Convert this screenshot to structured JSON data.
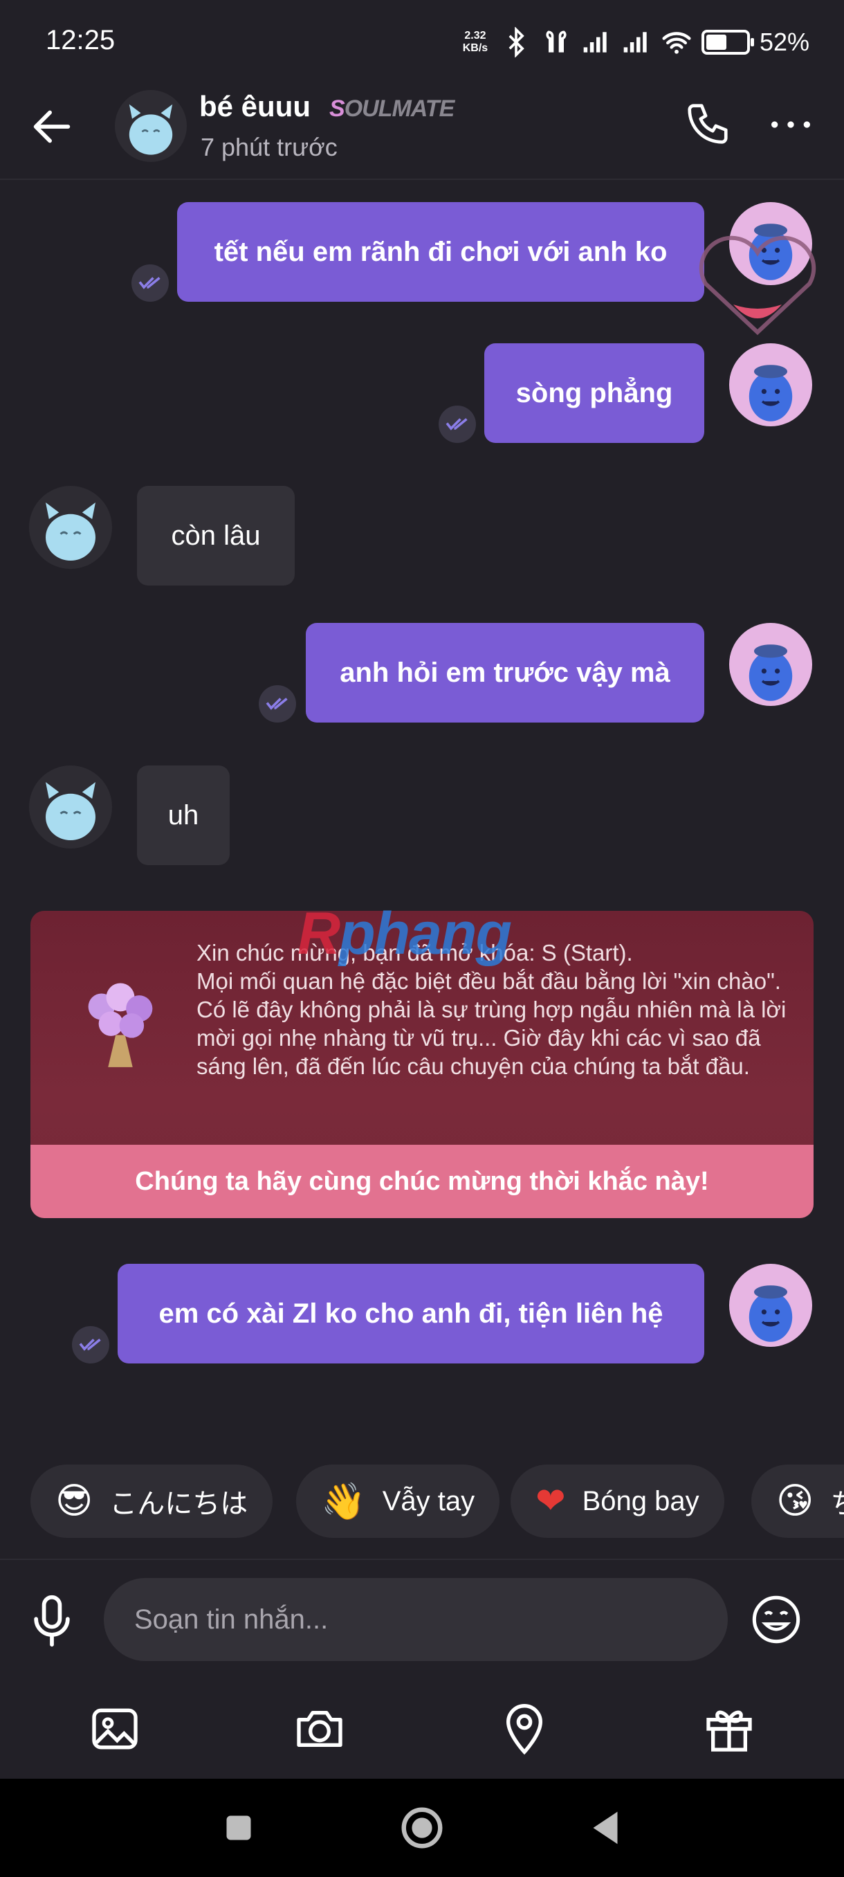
{
  "status_bar": {
    "time": "12:25",
    "net_speed_value": "2.32",
    "net_speed_unit": "KB/s",
    "battery_percent": "52%",
    "battery_level": 0.52
  },
  "header": {
    "contact_name": "bé êuuu",
    "badge_prefix": "S",
    "badge_rest": "OULMATE",
    "last_seen": "7 phút trước"
  },
  "messages": [
    {
      "direction": "out",
      "text": "tết nếu em rãnh đi chơi với anh ko"
    },
    {
      "direction": "out",
      "text": "sòng phẳng"
    },
    {
      "direction": "in",
      "text": "còn lâu"
    },
    {
      "direction": "out",
      "text": "anh hỏi em trước vậy mà"
    },
    {
      "direction": "in",
      "text": "uh"
    },
    {
      "direction": "out",
      "text": "em có xài Zl ko cho anh đi, tiện liên hệ"
    }
  ],
  "unlock_card": {
    "text": "Xin chúc mừng, bạn đã mở khóa: S (Start).\nMọi mối quan hệ đặc biệt đều bắt đầu bằng lời \"xin chào\". Có lẽ đây không phải là sự trùng hợp ngẫu nhiên mà là lời mời gọi nhẹ nhàng từ vũ trụ... Giờ đây khi các vì sao đã sáng lên, đã đến lúc câu chuyện của chúng ta bắt đầu.",
    "cta": "Chúng ta hãy cùng chúc mừng thời khắc này!"
  },
  "watermark": {
    "first": "R",
    "rest": "phang"
  },
  "quick_replies": [
    {
      "emoji": "😎",
      "label": "こんにちは"
    },
    {
      "emoji": "👋",
      "label": "Vẫy tay"
    },
    {
      "emoji": "❤",
      "label": "Bóng bay"
    },
    {
      "emoji": "😘",
      "label": "ち"
    }
  ],
  "input": {
    "placeholder": "Soạn tin nhắn..."
  },
  "colors": {
    "background": "#222027",
    "outgoing_bubble": "#7a5cd5",
    "incoming_bubble": "#333138",
    "cta": "#e27290"
  }
}
